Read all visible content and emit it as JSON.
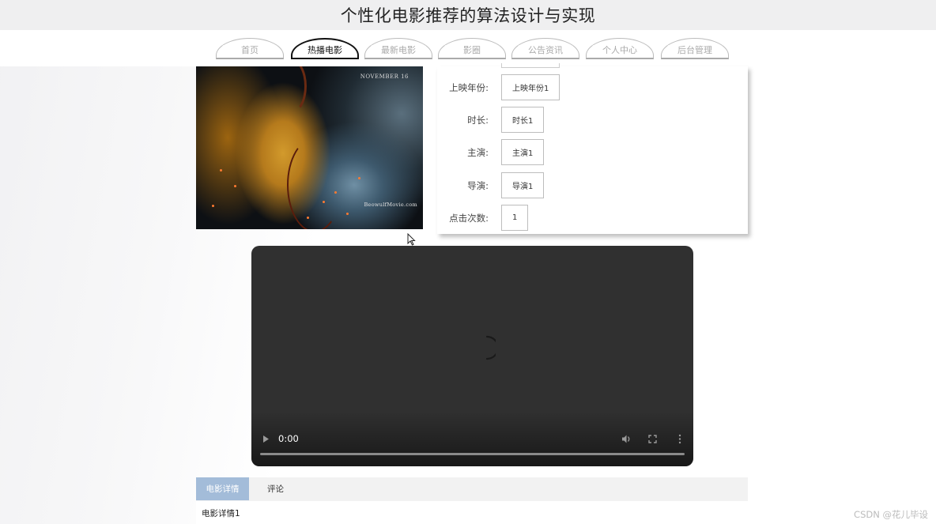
{
  "site_title": "个性化电影推荐的算法设计与实现",
  "nav": {
    "items": [
      {
        "label": "首页",
        "active": false
      },
      {
        "label": "热播电影",
        "active": true
      },
      {
        "label": "最新电影",
        "active": false
      },
      {
        "label": "影圈",
        "active": false
      },
      {
        "label": "公告资讯",
        "active": false
      },
      {
        "label": "个人中心",
        "active": false
      },
      {
        "label": "后台管理",
        "active": false
      }
    ]
  },
  "poster": {
    "date_text": "NOVEMBER 16",
    "site_text": "BeowulfMovie.com"
  },
  "movie_info": [
    {
      "label": "上映年份:",
      "value": "上映年份1"
    },
    {
      "label": "时长:",
      "value": "时长1"
    },
    {
      "label": "主演:",
      "value": "主演1"
    },
    {
      "label": "导演:",
      "value": "导演1"
    },
    {
      "label": "点击次数:",
      "value": "1"
    }
  ],
  "video": {
    "current_time": "0:00",
    "progress": 0,
    "state": "loading"
  },
  "tabs": {
    "details_label": "电影详情",
    "comments_label": "评论",
    "active": "details"
  },
  "details": {
    "content": "电影详情1"
  },
  "watermark": "CSDN @花儿毕设",
  "colors": {
    "active_tab": "#a3bcd9",
    "video_bg": "#303030",
    "title_bar": "#efeff0"
  }
}
